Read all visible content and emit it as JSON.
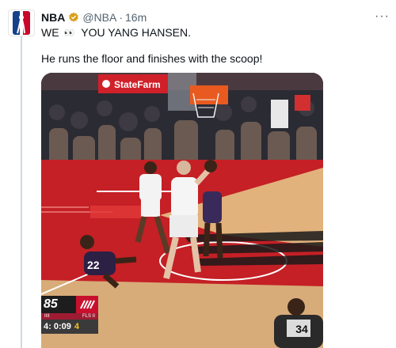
{
  "tweet": {
    "author_name": "NBA",
    "handle": "@NBA",
    "separator": "·",
    "time": "16m",
    "more": "···",
    "line1_before": "WE",
    "line1_emoji": "👀",
    "line1_after": "YOU YANG HANSEN.",
    "line2": "He runs the floor and finishes with the scoop!",
    "avatar_icon": "nba-logo-icon",
    "verified_icon": "verified-badge-icon",
    "verified_color": "#d8a11b"
  },
  "media": {
    "arena_sign": "StateFarm",
    "scorebug": {
      "score": "85",
      "team_left": "IIII",
      "team_right": "FLS II",
      "clock": "4: 0:09",
      "shot_clock": "4"
    },
    "referee_number": "34",
    "colors": {
      "court_red": "#c42026",
      "wood": "#e2b27c",
      "crowd": "#2b2b33"
    }
  }
}
